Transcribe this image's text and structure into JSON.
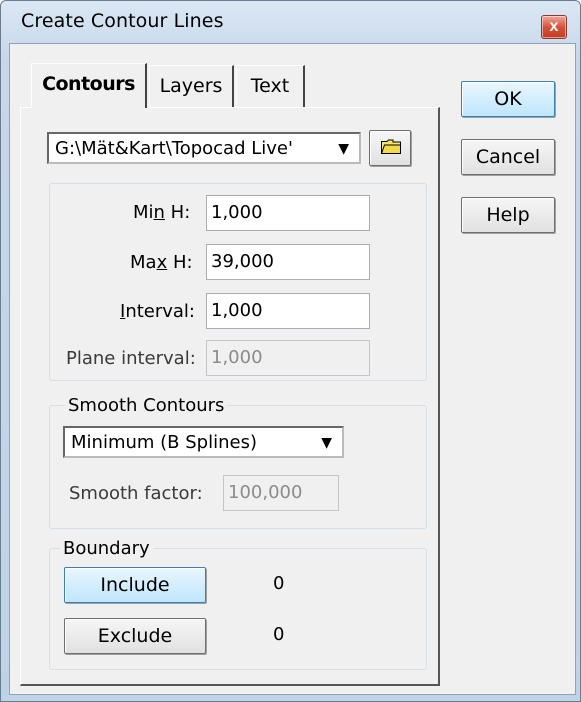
{
  "window": {
    "title": "Create Contour Lines",
    "close_glyph": "x"
  },
  "tabs": [
    {
      "label": "Contours",
      "active": true
    },
    {
      "label": "Layers",
      "active": false
    },
    {
      "label": "Text",
      "active": false
    }
  ],
  "file_select": {
    "value": "G:\\Mät&Kart\\Topocad Live'",
    "arrow": "▼",
    "browse_icon": "folder-icon"
  },
  "heights": {
    "min_label_pre": "Mi",
    "min_label_u": "n",
    "min_label_post": " H:",
    "min_value": "1,000",
    "max_label_pre": "Ma",
    "max_label_u": "x",
    "max_label_post": " H:",
    "max_value": "39,000",
    "interval_label_u": "I",
    "interval_label_post": "nterval:",
    "interval_value": "1,000",
    "plane_label": "Plane interval:",
    "plane_value": "1,000"
  },
  "smooth": {
    "legend": "Smooth Contours",
    "method": "Minimum (B Splines)",
    "arrow": "▼",
    "factor_label": "Smooth factor:",
    "factor_value": "100,000"
  },
  "boundary": {
    "legend": "Boundary",
    "include_label": "Include",
    "include_count": "0",
    "exclude_label": "Exclude",
    "exclude_count": "0"
  },
  "buttons": {
    "ok": "OK",
    "cancel": "Cancel",
    "help": "Help"
  }
}
